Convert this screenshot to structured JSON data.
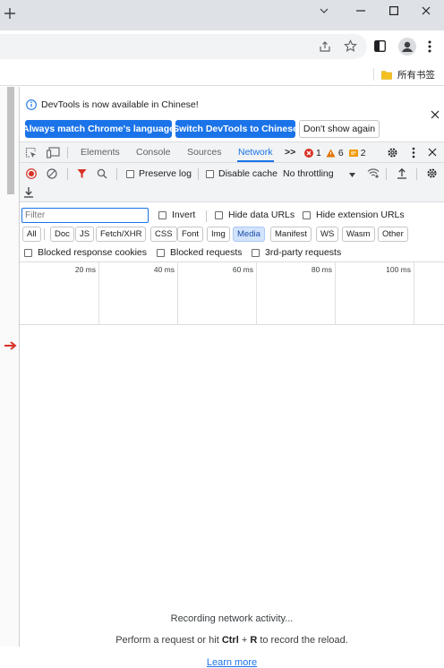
{
  "window": {
    "titlebar_color": "#dee1e6",
    "new_tab_icon": "plus-icon",
    "buttons": [
      "chevron-down-icon",
      "minimize-icon",
      "maximize-icon",
      "close-icon"
    ]
  },
  "toolbar": {
    "icons": [
      "share-icon",
      "star-icon",
      "sidepanel-icon",
      "profile-icon",
      "kebab-menu-icon"
    ]
  },
  "bookmarks": {
    "folder_label": "所有书签",
    "folder_color": "#f4c01e"
  },
  "devtools": {
    "infobar": {
      "message": "DevTools is now available in Chinese!",
      "btn_match": "Always match Chrome's language",
      "btn_switch": "Switch DevTools to Chinese",
      "btn_dont_show": "Don't show again"
    },
    "tabs": {
      "elements": "Elements",
      "console": "Console",
      "sources": "Sources",
      "network": "Network",
      "more": ">>",
      "errors": "1",
      "warnings": "6",
      "issues": "2"
    },
    "network_toolbar": {
      "preserve_log": "Preserve log",
      "disable_cache": "Disable cache",
      "throttling": "No throttling"
    },
    "filter": {
      "placeholder": "Filter",
      "invert": "Invert",
      "hide_data_urls": "Hide data URLs",
      "hide_extension_urls": "Hide extension URLs"
    },
    "types": [
      "All",
      "Doc",
      "JS",
      "Fetch/XHR",
      "CSS",
      "Font",
      "Img",
      "Media",
      "Manifest",
      "WS",
      "Wasm",
      "Other"
    ],
    "active_type": "Media",
    "blocking": {
      "blocked_cookies": "Blocked response cookies",
      "blocked_requests": "Blocked requests",
      "third_party": "3rd-party requests"
    },
    "timeline": {
      "ticks": [
        "20 ms",
        "40 ms",
        "60 ms",
        "80 ms",
        "100 ms"
      ]
    },
    "empty_state": {
      "recording": "Recording network activity...",
      "perform_prefix": "Perform a request or hit ",
      "ctrl": "Ctrl",
      "plus": " + ",
      "r": "R",
      "perform_suffix": " to record the reload.",
      "learn_more": "Learn more"
    },
    "colors": {
      "accent": "#1a73e8",
      "error": "#d93025",
      "warning": "#e37400",
      "issue": "#f29900"
    }
  }
}
